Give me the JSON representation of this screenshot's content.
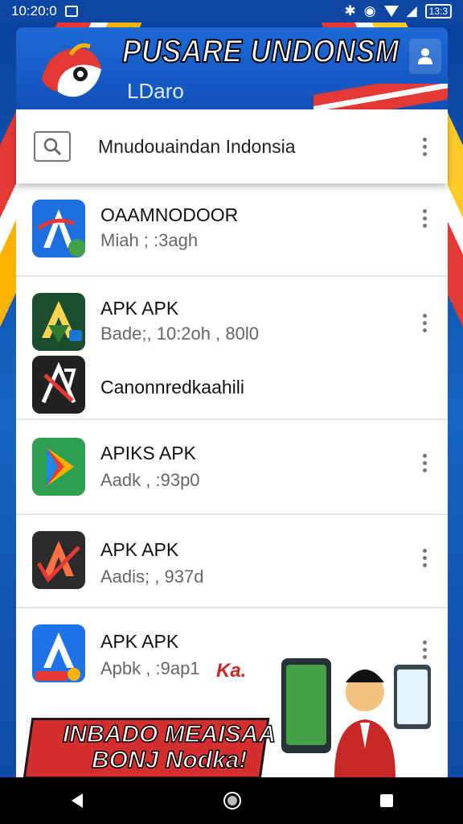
{
  "status": {
    "time": "10:20:0",
    "battery": "13:3"
  },
  "header": {
    "title": "PUSARE UNDONSM",
    "subtitle": "LDaro"
  },
  "search": {
    "text": "Mnudouaindan Indonsia"
  },
  "apps": [
    {
      "name": "OAAMNODOOR",
      "meta": "Miah ; :3agh"
    },
    {
      "name": "APK APK",
      "meta": "Bade;, 10:2oh , 80l0"
    },
    {
      "name": "Canonnredkaahili",
      "meta": ""
    },
    {
      "name": "APIKS APK",
      "meta": "Aadk , :93p0"
    },
    {
      "name": "APK APK",
      "meta": "Aadis; , 937d"
    },
    {
      "name": "APK APK",
      "meta": "Apbk , :9ap1"
    }
  ],
  "ad": {
    "line1": "INBADO MEAISAA",
    "line2": "BONJ Nodka!",
    "red_text": "Ka."
  },
  "colors": {
    "accent": "#1565c0",
    "red": "#e53935",
    "yellow": "#ffb300"
  }
}
